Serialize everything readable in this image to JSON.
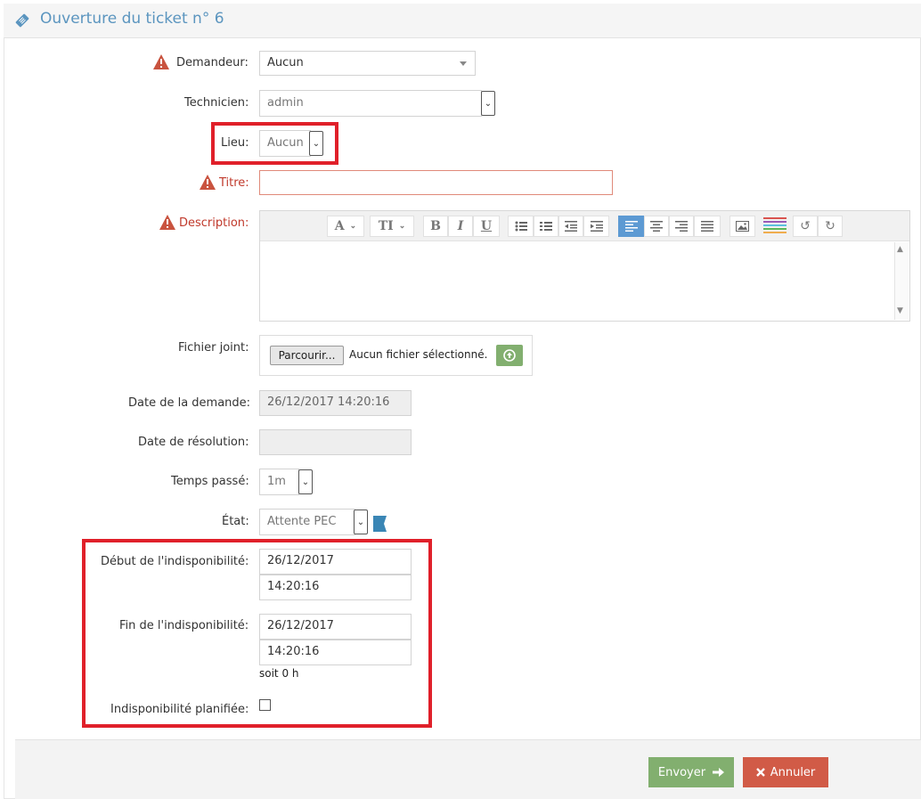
{
  "header": {
    "title": "Ouverture du ticket n° 6",
    "icon": "ticket-icon"
  },
  "form": {
    "demandeur": {
      "label": "Demandeur:",
      "value": "Aucun"
    },
    "technicien": {
      "label": "Technicien:",
      "value": "admin"
    },
    "lieu": {
      "label": "Lieu:",
      "value": "Aucun"
    },
    "titre": {
      "label": "Titre:",
      "value": ""
    },
    "description": {
      "label": "Description:"
    },
    "fichier": {
      "label": "Fichier joint:",
      "button": "Parcourir...",
      "status": "Aucun fichier sélectionné."
    },
    "date_demande": {
      "label": "Date de la demande:",
      "value": "26/12/2017 14:20:16"
    },
    "date_resolution": {
      "label": "Date de résolution:",
      "value": ""
    },
    "temps_passe": {
      "label": "Temps passé:",
      "value": "1m"
    },
    "etat": {
      "label": "État:",
      "value": "Attente PEC"
    },
    "debut": {
      "label": "Début de l'indisponibilité:",
      "date": "26/12/2017",
      "time": "14:20:16"
    },
    "fin": {
      "label": "Fin de l'indisponibilité:",
      "date": "26/12/2017",
      "time": "14:20:16",
      "duration": "soit 0 h"
    },
    "planifiee": {
      "label": "Indisponibilité planifiée:",
      "checked": false
    }
  },
  "editor_toolbar": [
    "A",
    "TI",
    "B",
    "I",
    "U"
  ],
  "actions": {
    "send": "Envoyer",
    "cancel": "Annuler"
  },
  "colors": {
    "accent": "#5b95bf",
    "required": "#c0392b",
    "send": "#82af6f",
    "cancel": "#d15b47",
    "highlight": "#e0202a"
  }
}
